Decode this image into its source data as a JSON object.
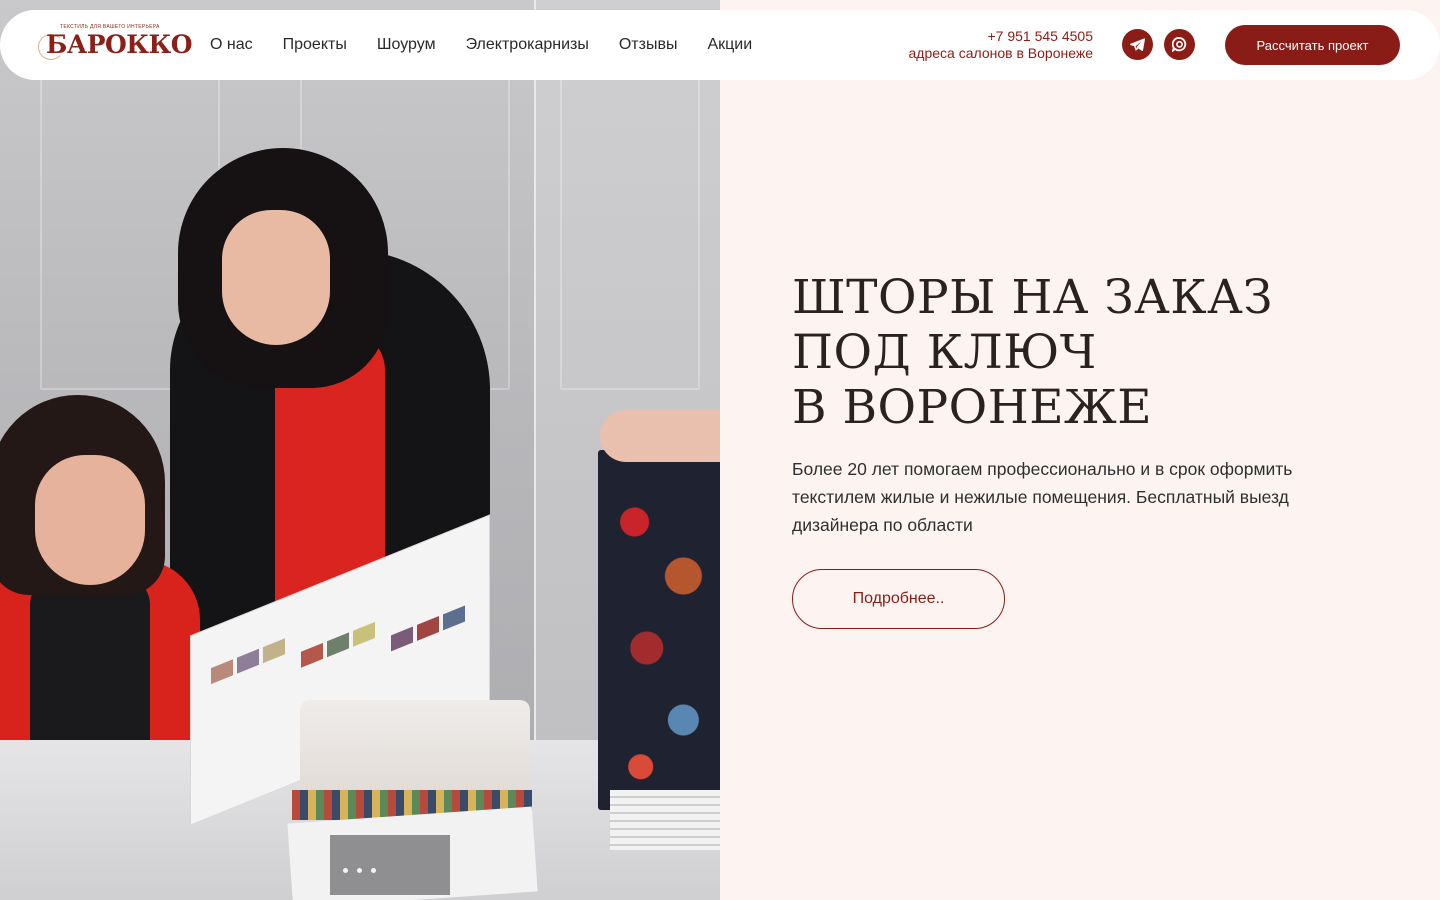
{
  "brand": {
    "logo_text": "БАРОККО",
    "logo_subtext": "ТЕКСТИЛЬ ДЛЯ ВАШЕГО ИНТЕРЬЕРА"
  },
  "nav": {
    "items": [
      {
        "label": "О нас"
      },
      {
        "label": "Проекты"
      },
      {
        "label": "Шоурум"
      },
      {
        "label": "Электрокарнизы"
      },
      {
        "label": "Отзывы"
      },
      {
        "label": "Акции"
      }
    ]
  },
  "contacts": {
    "phone": "+7 951 545 4505",
    "address_link": "адреса салонов в Воронеже"
  },
  "social": {
    "telegram_icon": "telegram-icon",
    "chat_icon": "chat-icon"
  },
  "header": {
    "cta_label": "Рассчитать проект"
  },
  "hero": {
    "title_lines": [
      "ШТОРЫ НА ЗАКАЗ",
      "ПОД КЛЮЧ",
      "В ВОРОНЕЖЕ"
    ],
    "description": "Более 20 лет помогаем профессионально и в срок оформить текстилем жилые и нежилые помещения. Бесплатный выезд дизайнера по области",
    "button_label": "Подробнее..",
    "slider_dots": 3
  },
  "colors": {
    "accent": "#8a1c17",
    "background": "#fdf4f2",
    "header_bg": "#ffffff",
    "title": "#2a2220"
  }
}
